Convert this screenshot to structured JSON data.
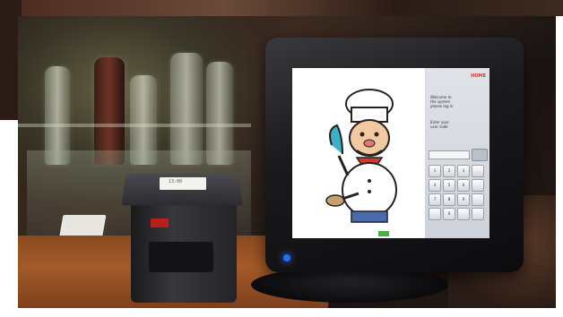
{
  "scene": {
    "description_items": [
      "receipt-printer",
      "pos-terminal",
      "bar-background",
      "wooden-counter"
    ]
  },
  "printer": {
    "paper_text": "13:00"
  },
  "terminal": {
    "screen": {
      "logo": "HOME",
      "text_block_1": "Welcome to\nthe system\nplease log in",
      "text_block_2": "Enter your\nuser code",
      "keypad_keys": [
        "1",
        "2",
        "3",
        "",
        "4",
        "5",
        "6",
        "",
        "7",
        "8",
        "9",
        "",
        "",
        "0",
        "",
        ""
      ]
    }
  },
  "colors": {
    "counter_wood": "#a35a28",
    "printer_label": "#b81e1e",
    "power_led": "#2a6cff",
    "screen_tab": "#4ab04a"
  },
  "icons": {
    "chef": "chef-mascot-icon",
    "power": "power-led-icon"
  }
}
